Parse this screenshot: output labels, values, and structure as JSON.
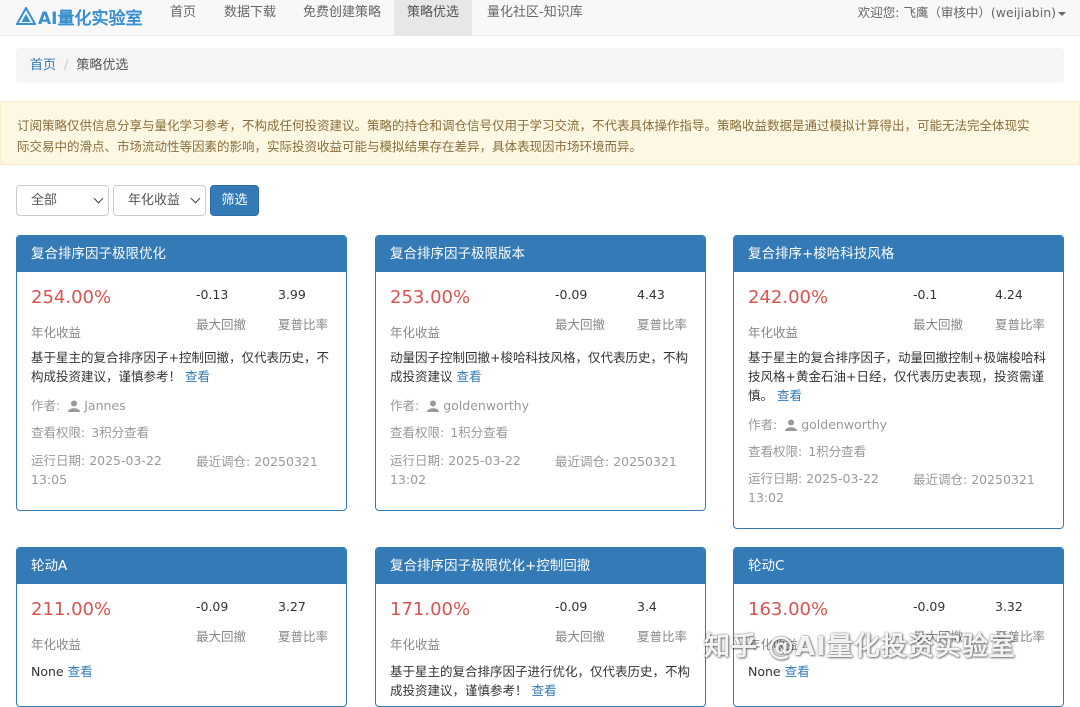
{
  "navbar": {
    "brand": "AI量化实验室",
    "items": [
      {
        "label": "首页"
      },
      {
        "label": "数据下载"
      },
      {
        "label": "免费创建策略"
      },
      {
        "label": "策略优选",
        "active": true
      },
      {
        "label": "量化社区-知识库"
      }
    ],
    "user": "欢迎您:  飞鹰（审核中）(weijiabin)"
  },
  "breadcrumb": {
    "home": "首页",
    "separator": "/",
    "current": "策略优选"
  },
  "alert": {
    "line1": "订阅策略仅供信息分享与量化学习参考，不构成任何投资建议。策略的持仓和调仓信号仅用于学习交流，不代表具体操作指导。策略收益数据是通过模拟计算得出，可能无法完全体现实",
    "line2": "际交易中的滑点、市场流动性等因素的影响，实际投资收益可能与模拟结果存在差异，具体表现因市场环境而异。"
  },
  "filters": {
    "category": "全部",
    "sort": "年化收益",
    "button": "筛选"
  },
  "labels": {
    "annual_return": "年化收益",
    "max_drawdown": "最大回撤",
    "sharpe": "夏普比率",
    "view": "查看",
    "author": "作者:",
    "permission": "查看权限:",
    "run_date": "运行日期:",
    "last_rebalance": "最近调仓:"
  },
  "cards": [
    {
      "title": "复合排序因子极限优化",
      "ret": "254.00%",
      "mdd": "-0.13",
      "sharpe": "3.99",
      "desc": "基于星主的复合排序因子+控制回撤，仅代表历史，不构成投资建议，谨慎参考！",
      "author": "Jannes",
      "permission": "3积分查看",
      "run_date": "2025-03-22 13:05",
      "last_rebalance": "20250321"
    },
    {
      "title": "复合排序因子极限版本",
      "ret": "253.00%",
      "mdd": "-0.09",
      "sharpe": "4.43",
      "desc": "动量因子控制回撤+梭哈科技风格，仅代表历史，不构成投资建议",
      "author": "goldenworthy",
      "permission": "1积分查看",
      "run_date": "2025-03-22 13:02",
      "last_rebalance": "20250321"
    },
    {
      "title": "复合排序+梭哈科技风格",
      "ret": "242.00%",
      "mdd": "-0.1",
      "sharpe": "4.24",
      "desc": "基于星主的复合排序因子，动量回撤控制+极端梭哈科技风格+黄金石油+日经，仅代表历史表现，投资需谨慎。",
      "author": "goldenworthy",
      "permission": "1积分查看",
      "run_date": "2025-03-22 13:02",
      "last_rebalance": "20250321"
    },
    {
      "title": "轮动A",
      "ret": "211.00%",
      "mdd": "-0.09",
      "sharpe": "3.27",
      "desc": "None"
    },
    {
      "title": "复合排序因子极限优化+控制回撤",
      "ret": "171.00%",
      "mdd": "-0.09",
      "sharpe": "3.4",
      "desc": "基于星主的复合排序因子进行优化，仅代表历史，不构成投资建议，谨慎参考！"
    },
    {
      "title": "轮动C",
      "ret": "163.00%",
      "mdd": "-0.09",
      "sharpe": "3.32",
      "desc": "None"
    }
  ],
  "watermark": "知乎 @AI量化投资实验室"
}
